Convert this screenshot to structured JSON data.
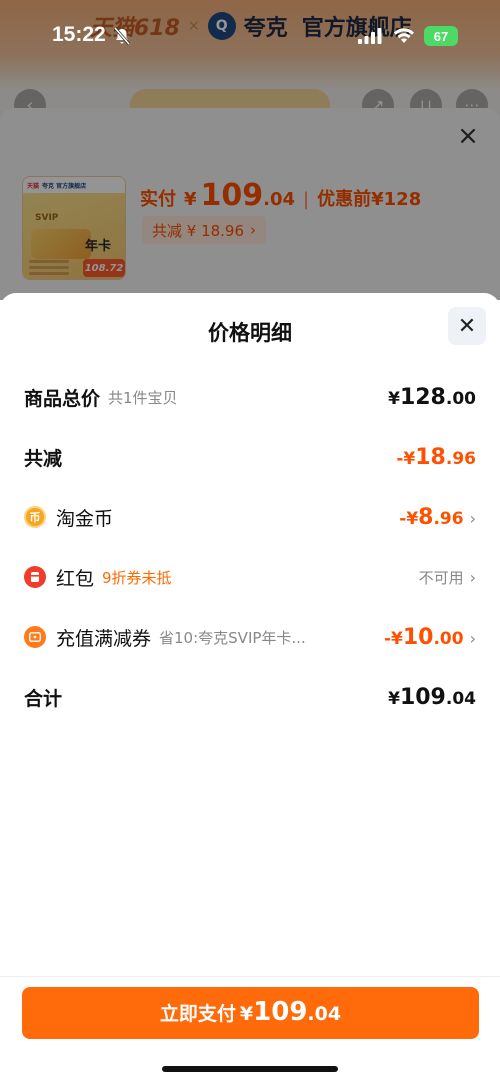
{
  "status_bar": {
    "time": "15:22",
    "battery": "67"
  },
  "store_banner": {
    "event_logo": "天猫618",
    "separator": "×",
    "brand_mark": "Q",
    "brand": "夸克",
    "official_store": "官方旗舰店"
  },
  "product_sheet": {
    "thumb": {
      "brand_a": "天猫",
      "brand_b": "夸克 官方旗舰店",
      "svip": "SVIP",
      "year_card": "年卡",
      "price": "108.72"
    },
    "pay_label": "实付",
    "pay_yen": "¥",
    "pay_int": "109",
    "pay_dec": ".04",
    "separator": "|",
    "original_price": "优惠前¥128",
    "total_reduce": "共减 ¥ 18.96",
    "chevron": "›"
  },
  "modal": {
    "title": "价格明细",
    "rows": [
      {
        "label": "商品总价",
        "sub": "共1件宝贝",
        "yen": "¥",
        "int": "128",
        "dec": ".00"
      },
      {
        "label": "共减",
        "yen": "-¥",
        "int": "18",
        "dec": ".96"
      },
      {
        "label": "淘金币",
        "icon": "币",
        "yen": "-¥",
        "int": "8",
        "dec": ".96"
      },
      {
        "label": "红包",
        "sub": "9折券未抵",
        "status": "不可用"
      },
      {
        "label": "充值满减券",
        "sub": "省10:夸克SVIP年卡...",
        "yen": "-¥",
        "int": "10",
        "dec": ".00"
      },
      {
        "label": "合计",
        "yen": "¥",
        "int": "109",
        "dec": ".04"
      }
    ],
    "chevron": "›"
  },
  "footer": {
    "pay_label": "立即支付",
    "yen": "¥",
    "int": "109",
    "dec": ".04"
  },
  "colors": {
    "accent": "#ff5000",
    "button": "#ff6a0a",
    "success": "#4cd964"
  }
}
